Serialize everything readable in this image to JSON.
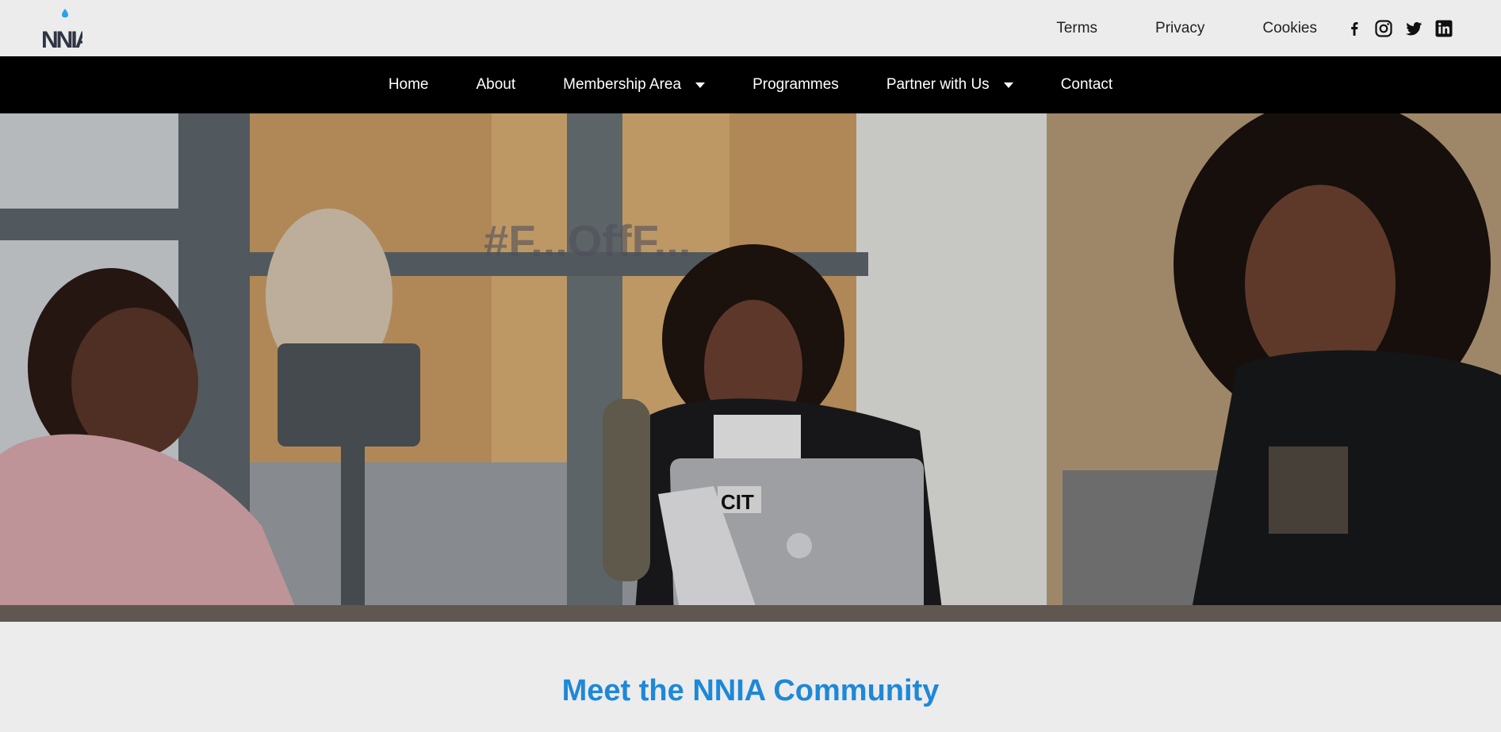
{
  "brand": {
    "logo_text": "NNIA"
  },
  "top_links": [
    "Terms",
    "Privacy",
    "Cookies"
  ],
  "social_icons": [
    "facebook-icon",
    "instagram-icon",
    "twitter-icon",
    "linkedin-icon"
  ],
  "nav": [
    {
      "label": "Home",
      "dropdown": false
    },
    {
      "label": "About",
      "dropdown": false
    },
    {
      "label": "Membership Area",
      "dropdown": true
    },
    {
      "label": "Programmes",
      "dropdown": false
    },
    {
      "label": "Partner with Us",
      "dropdown": true
    },
    {
      "label": "Contact",
      "dropdown": false
    }
  ],
  "hero": {
    "laptop_sticker": "CIT",
    "poster_text": "#F...OffF..."
  },
  "section": {
    "title": "Meet the NNIA Community"
  },
  "colors": {
    "accent": "#1e88d8",
    "nav_bg": "#000000",
    "page_bg": "#ececec"
  }
}
